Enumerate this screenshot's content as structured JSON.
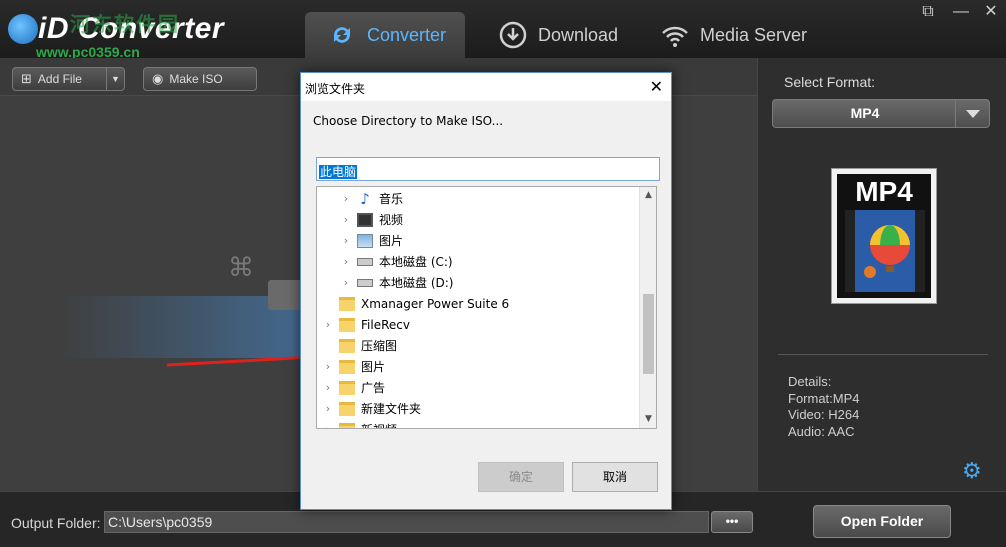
{
  "app": {
    "title": "iD Converter",
    "watermark": "www.pc0359.cn",
    "watermark_top": "河东软件园"
  },
  "tabs": [
    {
      "label": "Converter",
      "icon": "refresh-icon",
      "active": true
    },
    {
      "label": "Download",
      "icon": "download-icon",
      "active": false
    },
    {
      "label": "Media Server",
      "icon": "wifi-icon",
      "active": false
    }
  ],
  "window_controls": {
    "restore": "⧉",
    "minimize": "—",
    "close": "✕"
  },
  "toolbar": {
    "add_file": "Add File",
    "make_iso": "Make ISO"
  },
  "right_panel": {
    "select_format_label": "Select Format:",
    "format": "MP4",
    "thumb_text": "MP4",
    "details": {
      "title": "Details:",
      "format": "Format:MP4",
      "video": "Video: H264",
      "audio": "Audio: AAC"
    }
  },
  "bottom": {
    "output_folder_label": "Output Folder:",
    "output_path": "C:\\Users\\pc0359",
    "browse_label": "•••",
    "open_folder": "Open Folder"
  },
  "dialog": {
    "title": "浏览文件夹",
    "close": "✕",
    "description": "Choose Directory to Make ISO...",
    "path": "此电脑",
    "tree": [
      {
        "label": "音乐",
        "icon": "music-icon",
        "expandable": true,
        "level": 1
      },
      {
        "label": "视频",
        "icon": "video-icon",
        "expandable": true,
        "level": 1
      },
      {
        "label": "图片",
        "icon": "picture-icon",
        "expandable": true,
        "level": 1
      },
      {
        "label": "本地磁盘 (C:)",
        "icon": "disk-icon",
        "expandable": true,
        "level": 1
      },
      {
        "label": "本地磁盘 (D:)",
        "icon": "disk-icon",
        "expandable": true,
        "level": 1
      },
      {
        "label": "Xmanager Power Suite 6",
        "icon": "folder-icon",
        "expandable": false,
        "level": 0
      },
      {
        "label": "FileRecv",
        "icon": "folder-icon",
        "expandable": true,
        "level": 0
      },
      {
        "label": "压缩图",
        "icon": "folder-icon",
        "expandable": false,
        "level": 0
      },
      {
        "label": "图片",
        "icon": "folder-icon",
        "expandable": true,
        "level": 0
      },
      {
        "label": "广告",
        "icon": "folder-icon",
        "expandable": true,
        "level": 0
      },
      {
        "label": "新建文件夹",
        "icon": "folder-icon",
        "expandable": true,
        "level": 0
      },
      {
        "label": "新视频",
        "icon": "folder-icon",
        "expandable": true,
        "level": 0
      }
    ],
    "ok": "确定",
    "cancel": "取消"
  },
  "colors": {
    "accent_blue": "#5cb6ff",
    "arrow_red": "#e0201a",
    "selection_blue": "#0078d7"
  }
}
